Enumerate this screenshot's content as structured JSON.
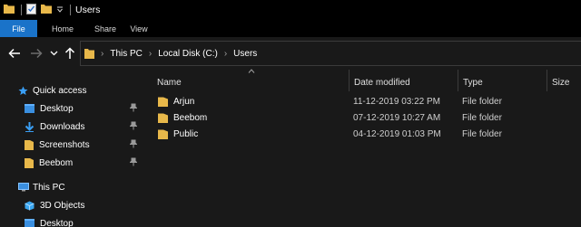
{
  "window": {
    "title": "Users"
  },
  "ribbon": {
    "tabs": [
      "File",
      "Home",
      "Share",
      "View"
    ]
  },
  "address": {
    "crumbs": [
      "This PC",
      "Local Disk (C:)",
      "Users"
    ]
  },
  "sidebar": {
    "quick_access": "Quick access",
    "pinned": [
      "Desktop",
      "Downloads",
      "Screenshots",
      "Beebom"
    ],
    "this_pc": "This PC",
    "this_pc_items": [
      "3D Objects",
      "Desktop"
    ]
  },
  "columns": {
    "name": "Name",
    "date": "Date modified",
    "type": "Type",
    "size": "Size"
  },
  "files": [
    {
      "name": "Arjun",
      "date": "11-12-2019 03:22 PM",
      "type": "File folder"
    },
    {
      "name": "Beebom",
      "date": "07-12-2019 10:27 AM",
      "type": "File folder"
    },
    {
      "name": "Public",
      "date": "04-12-2019 01:03 PM",
      "type": "File folder"
    }
  ],
  "colors": {
    "accent": "#1a73c9",
    "folder": "#e8b84a",
    "background": "#191919"
  }
}
